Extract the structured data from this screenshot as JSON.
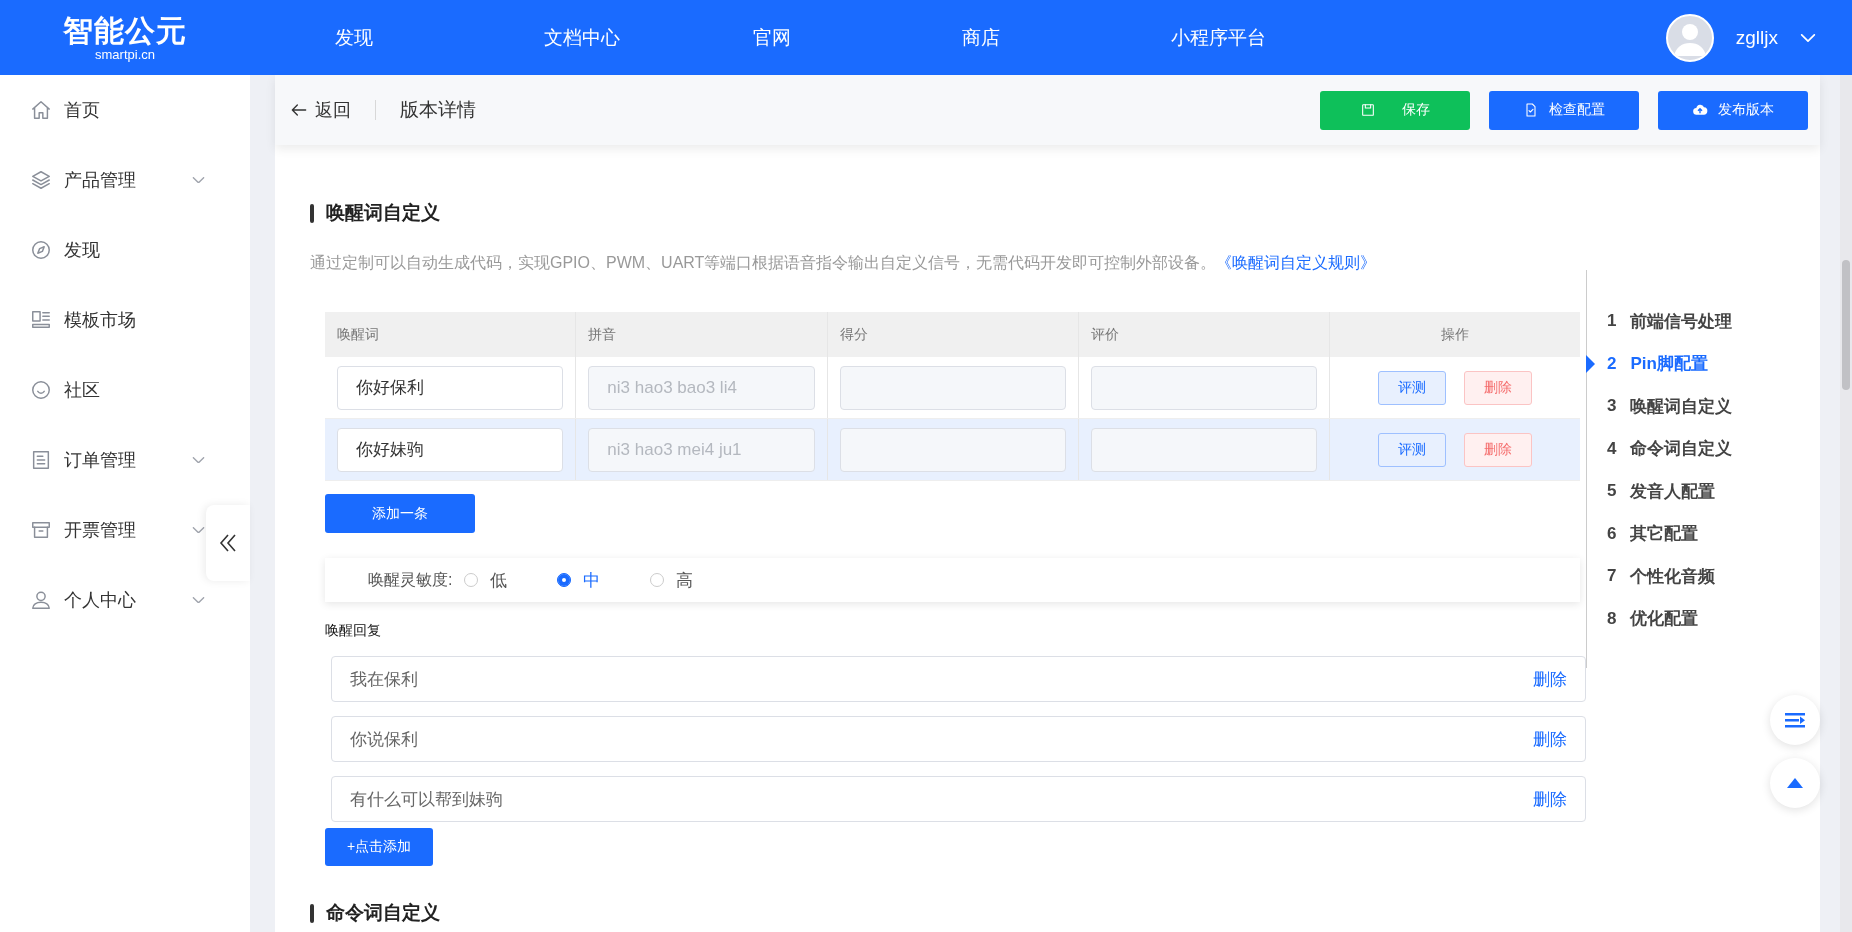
{
  "logo": {
    "name": "智能公元",
    "domain": "smartpi.cn"
  },
  "top_nav": [
    {
      "label": "发现"
    },
    {
      "label": "文档中心"
    },
    {
      "label": "官网"
    },
    {
      "label": "商店"
    },
    {
      "label": "小程序平台"
    }
  ],
  "user": {
    "name": "zglljx"
  },
  "sidebar": {
    "items": [
      {
        "label": "首页",
        "expandable": false
      },
      {
        "label": "产品管理",
        "expandable": true
      },
      {
        "label": "发现",
        "expandable": false
      },
      {
        "label": "模板市场",
        "expandable": false
      },
      {
        "label": "社区",
        "expandable": false
      },
      {
        "label": "订单管理",
        "expandable": true
      },
      {
        "label": "开票管理",
        "expandable": true
      },
      {
        "label": "个人中心",
        "expandable": true
      }
    ]
  },
  "header": {
    "back": "返回",
    "title": "版本详情",
    "buttons": [
      {
        "label": "保存",
        "kind": "save"
      },
      {
        "label": "检查配置",
        "kind": "check"
      },
      {
        "label": "发布版本",
        "kind": "publish"
      }
    ]
  },
  "section": {
    "title": "唤醒词自定义",
    "description": "通过定制可以自动生成代码，实现GPIO、PWM、UART等端口根据语音指令输出自定义信号，无需代码开发即可控制外部设备。",
    "link": "《唤醒词自定义规则》"
  },
  "table": {
    "columns": [
      "唤醒词",
      "拼音",
      "得分",
      "评价",
      "操作"
    ],
    "rows": [
      {
        "highlighted": false,
        "word": "你好保利",
        "pinyin": "ni3 hao3 bao3 li4",
        "actions": [
          "评测",
          "删除"
        ]
      },
      {
        "highlighted": true,
        "word": "你好妹驹",
        "pinyin": "ni3 hao3 mei4 ju1",
        "actions": [
          "评测",
          "删除"
        ]
      }
    ]
  },
  "add_row_button": "添加一条",
  "sensitivity": {
    "label": "唤醒灵敏度:",
    "options": [
      {
        "label": "低",
        "selected": false
      },
      {
        "label": "中",
        "selected": true
      },
      {
        "label": "高",
        "selected": false
      }
    ]
  },
  "replies": {
    "label": "唤醒回复",
    "items": [
      {
        "text": "我在保利",
        "delete": "删除"
      },
      {
        "text": "你说保利",
        "delete": "删除"
      },
      {
        "text": "有什么可以帮到妹驹",
        "delete": "删除"
      }
    ],
    "add_button": "+点击添加"
  },
  "next_section": {
    "title": "命令词自定义"
  },
  "anchor_nav": [
    {
      "number": "1",
      "label": "前端信号处理",
      "selected": false
    },
    {
      "number": "2",
      "label": "Pin脚配置",
      "selected": true
    },
    {
      "number": "3",
      "label": "唤醒词自定义",
      "selected": false
    },
    {
      "number": "4",
      "label": "命令词自定义",
      "selected": false
    },
    {
      "number": "5",
      "label": "发音人配置",
      "selected": false
    },
    {
      "number": "6",
      "label": "其它配置",
      "selected": false
    },
    {
      "number": "7",
      "label": "个性化音频",
      "selected": false
    },
    {
      "number": "8",
      "label": "优化配置",
      "selected": false
    }
  ]
}
